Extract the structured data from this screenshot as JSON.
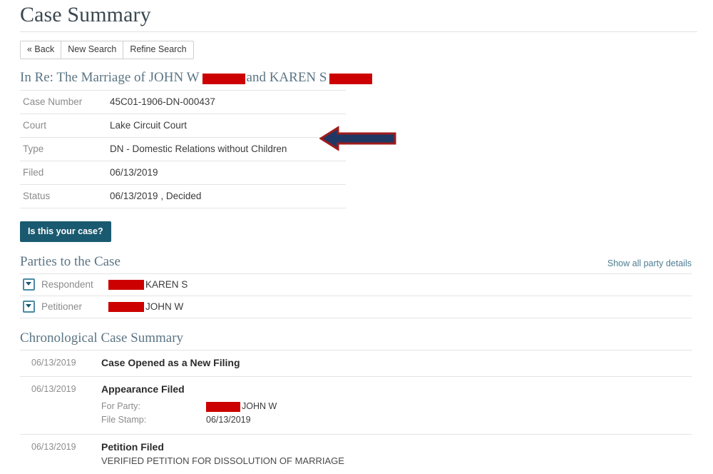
{
  "page": {
    "title": "Case Summary"
  },
  "toolbar": {
    "buttons": [
      {
        "label": "« Back",
        "name": "back-button"
      },
      {
        "label": "New Search",
        "name": "new-search-button"
      },
      {
        "label": "Refine Search",
        "name": "refine-search-button"
      }
    ]
  },
  "case_heading": {
    "prefix": "In Re: The Marriage of JOHN W",
    "middle": "and KAREN S",
    "redacted_1": "",
    "redacted_2": ""
  },
  "case_details": {
    "rows": [
      {
        "label": "Case Number",
        "value": "45C01-1906-DN-000437"
      },
      {
        "label": "Court",
        "value": "Lake Circuit Court"
      },
      {
        "label": "Type",
        "value": "DN - Domestic Relations without Children"
      },
      {
        "label": "Filed",
        "value": "06/13/2019"
      },
      {
        "label": "Status",
        "value": "06/13/2019 , Decided"
      }
    ]
  },
  "claim": {
    "label": "Is this your case?"
  },
  "parties": {
    "heading": "Parties to the Case",
    "show_all_label": "Show all party details",
    "rows": [
      {
        "role": "Respondent",
        "name": "KAREN S"
      },
      {
        "role": "Petitioner",
        "name": "JOHN W"
      }
    ]
  },
  "chronological": {
    "heading": "Chronological Case Summary",
    "events": [
      {
        "date": "06/13/2019",
        "title": "Case Opened as a New Filing"
      },
      {
        "date": "06/13/2019",
        "title": "Appearance Filed",
        "fields": [
          {
            "key": "For Party:",
            "value": "JOHN W",
            "redacted": true
          },
          {
            "key": "File Stamp:",
            "value": "06/13/2019",
            "redacted": false
          }
        ]
      },
      {
        "date": "06/13/2019",
        "title": "Petition Filed",
        "description": "VERIFIED PETITION FOR DISSOLUTION OF MARRIAGE"
      }
    ]
  },
  "annotation": {
    "arrow_direction": "left",
    "fill_color": "#1f3864",
    "outline_color": "#9e1b1b",
    "points_at": "Type"
  },
  "colors": {
    "heading_blue": "#5b7584",
    "accent_teal": "#1a5a70",
    "redaction_red": "#cc0000",
    "link_blue": "#4c7d93"
  }
}
